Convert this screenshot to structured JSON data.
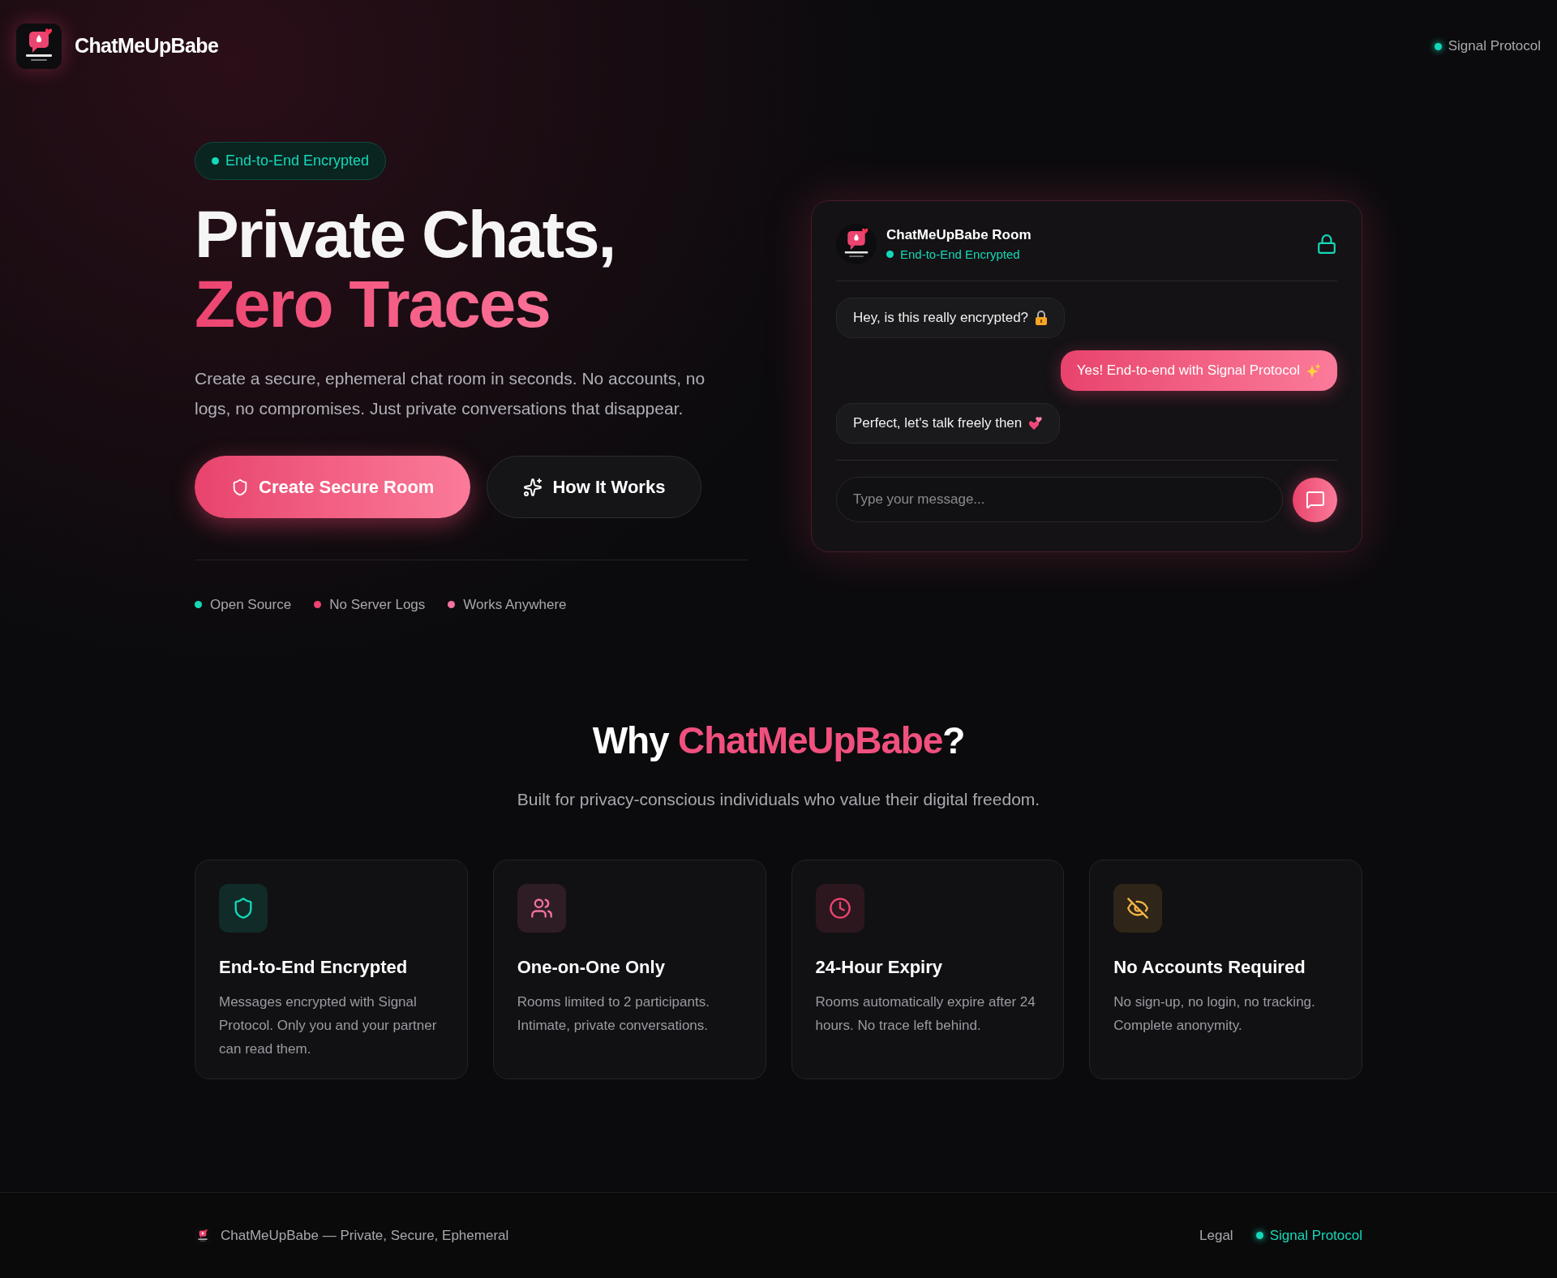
{
  "header": {
    "brand": "ChatMeUpBabe",
    "status": "Signal Protocol"
  },
  "hero": {
    "badge": "End-to-End Encrypted",
    "title_line1": "Private Chats,",
    "title_line2": "Zero Traces",
    "description": "Create a secure, ephemeral chat room in seconds. No accounts, no logs, no compromises. Just private conversations that disappear.",
    "buttons": [
      {
        "kind": "primary",
        "label": "Create Secure Room"
      },
      {
        "kind": "secondary",
        "label": "How It Works"
      }
    ],
    "highlights": [
      {
        "label": "Open Source",
        "color": "#14d9b8"
      },
      {
        "label": "No Server Logs",
        "color": "#ec4470"
      },
      {
        "label": "Works Anywhere",
        "color": "#f472a0"
      }
    ]
  },
  "chat_preview": {
    "room": "ChatMeUpBabe Room",
    "status": "End-to-End Encrypted",
    "messages": [
      {
        "kind": "incoming",
        "text": "Hey, is this really encrypted?"
      },
      {
        "kind": "outgoing",
        "text": "Yes! End-to-end with Signal Protocol"
      },
      {
        "kind": "incoming",
        "text": "Perfect, let's talk freely then"
      }
    ],
    "input": {
      "placeholder": "Type your message..."
    }
  },
  "features": {
    "title_prefix": "Why ",
    "title_brand": "ChatMeUpBabe",
    "title_suffix": "?",
    "subtitle": "Built for privacy-conscious individuals who value their digital freedom.",
    "cards": [
      {
        "color": "#14d9b8",
        "title": "End-to-End Encrypted",
        "text": "Messages encrypted with Signal Protocol. Only you and your partner can read them."
      },
      {
        "color": "#f472a0",
        "title": "One-on-One Only",
        "text": "Rooms limited to 2 participants. Intimate, private conversations."
      },
      {
        "color": "#ec4470",
        "title": "24-Hour Expiry",
        "text": "Rooms automatically expire after 24 hours. No trace left behind."
      },
      {
        "color": "#f5b545",
        "title": "No Accounts Required",
        "text": "No sign-up, no login, no tracking. Complete anonymity."
      }
    ]
  },
  "footer": {
    "tagline": "ChatMeUpBabe — Private, Secure, Ephemeral",
    "links": [
      {
        "kind": "plain",
        "label": "Legal"
      },
      {
        "kind": "status",
        "label": "Signal Protocol"
      }
    ]
  }
}
